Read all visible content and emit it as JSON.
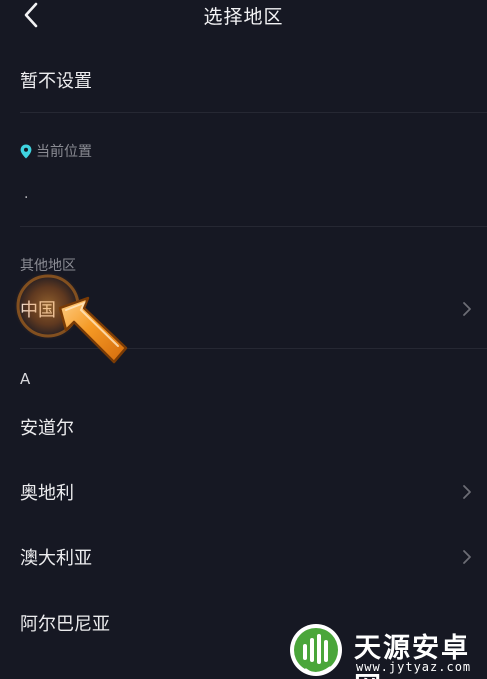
{
  "header": {
    "title": "选择地区"
  },
  "rows": {
    "no_setting": "暂不设置",
    "current_location_title": "当前位置",
    "current_location_value": "·",
    "other_regions_title": "其他地区",
    "china": "中国",
    "letter_a": "A",
    "andorra": "安道尔",
    "austria": "奥地利",
    "australia": "澳大利亚",
    "albania": "阿尔巴尼亚"
  },
  "watermark": {
    "brand": "天源安卓网",
    "url": "www.jytyaz.com"
  },
  "colors": {
    "background": "#161823",
    "accent_location": "#3fd3e0",
    "pointer_orange": "#f08a1c"
  },
  "icons": {
    "back": "chevron-left-icon",
    "location": "location-pin-icon",
    "row_arrow": "chevron-right-icon",
    "pointer": "hand-pointer-arrow-icon"
  }
}
